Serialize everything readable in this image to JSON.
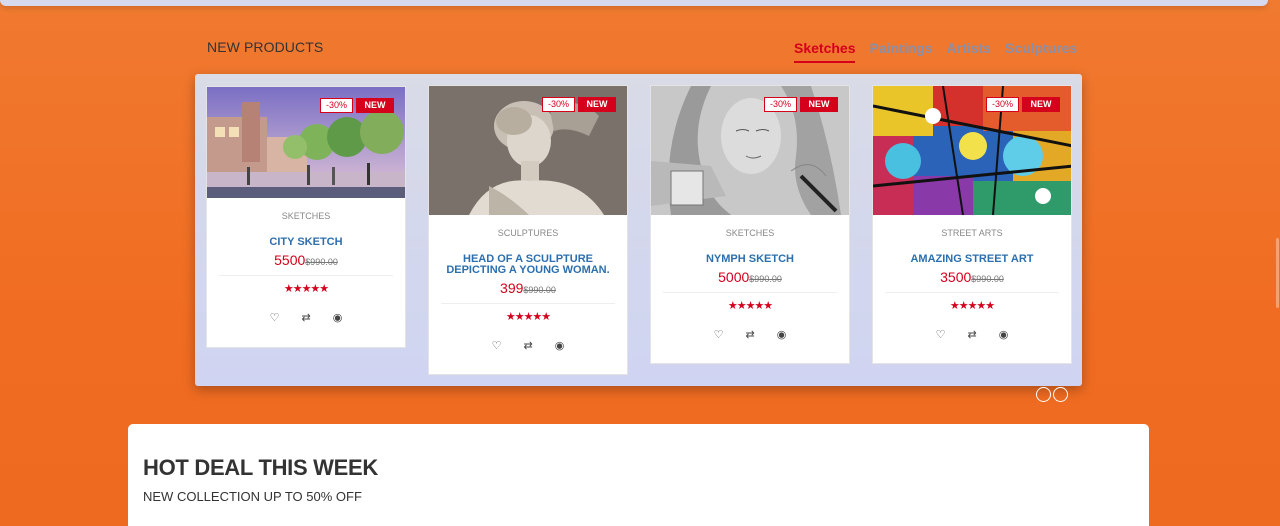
{
  "section": {
    "title": "NEW PRODUCTS",
    "tabs": [
      "Sketches",
      "Paintings",
      "Artists",
      "Sculptures"
    ],
    "active_tab": "Sketches"
  },
  "products": [
    {
      "sale_badge": "-30%",
      "new_badge": "NEW",
      "category": "SKETCHES",
      "name": "CITY SKETCH",
      "price": "5500",
      "old_price": "$990.00",
      "rating_stars": "★★★★★",
      "rating": 5,
      "icons": [
        "heart-icon",
        "compare-icon",
        "eye-icon"
      ]
    },
    {
      "sale_badge": "-30%",
      "new_badge": "NEW",
      "category": "SCULPTURES",
      "name": "HEAD OF A SCULPTURE DEPICTING A YOUNG WOMAN.",
      "price": "399",
      "old_price": "$990.00",
      "rating_stars": "★★★★★",
      "rating": 5,
      "icons": [
        "heart-icon",
        "compare-icon",
        "eye-icon"
      ]
    },
    {
      "sale_badge": "-30%",
      "new_badge": "NEW",
      "category": "SKETCHES",
      "name": "NYMPH SKETCH",
      "price": "5000",
      "old_price": "$990.00",
      "rating_stars": "★★★★★",
      "rating": 5,
      "icons": [
        "heart-icon",
        "compare-icon",
        "eye-icon"
      ]
    },
    {
      "sale_badge": "-30%",
      "new_badge": "NEW",
      "category": "STREET ARTS",
      "name": "AMAZING STREET ART",
      "price": "3500",
      "old_price": "$990.00",
      "rating_stars": "★★★★★",
      "rating": 5,
      "icons": [
        "heart-icon",
        "compare-icon",
        "eye-icon"
      ]
    }
  ],
  "deal": {
    "title": "HOT DEAL THIS WEEK",
    "subtitle": "NEW COLLECTION UP TO 50% OFF"
  },
  "colors": {
    "accent": "#d4001c",
    "link": "#2c6fae",
    "background": "#f07a30"
  }
}
